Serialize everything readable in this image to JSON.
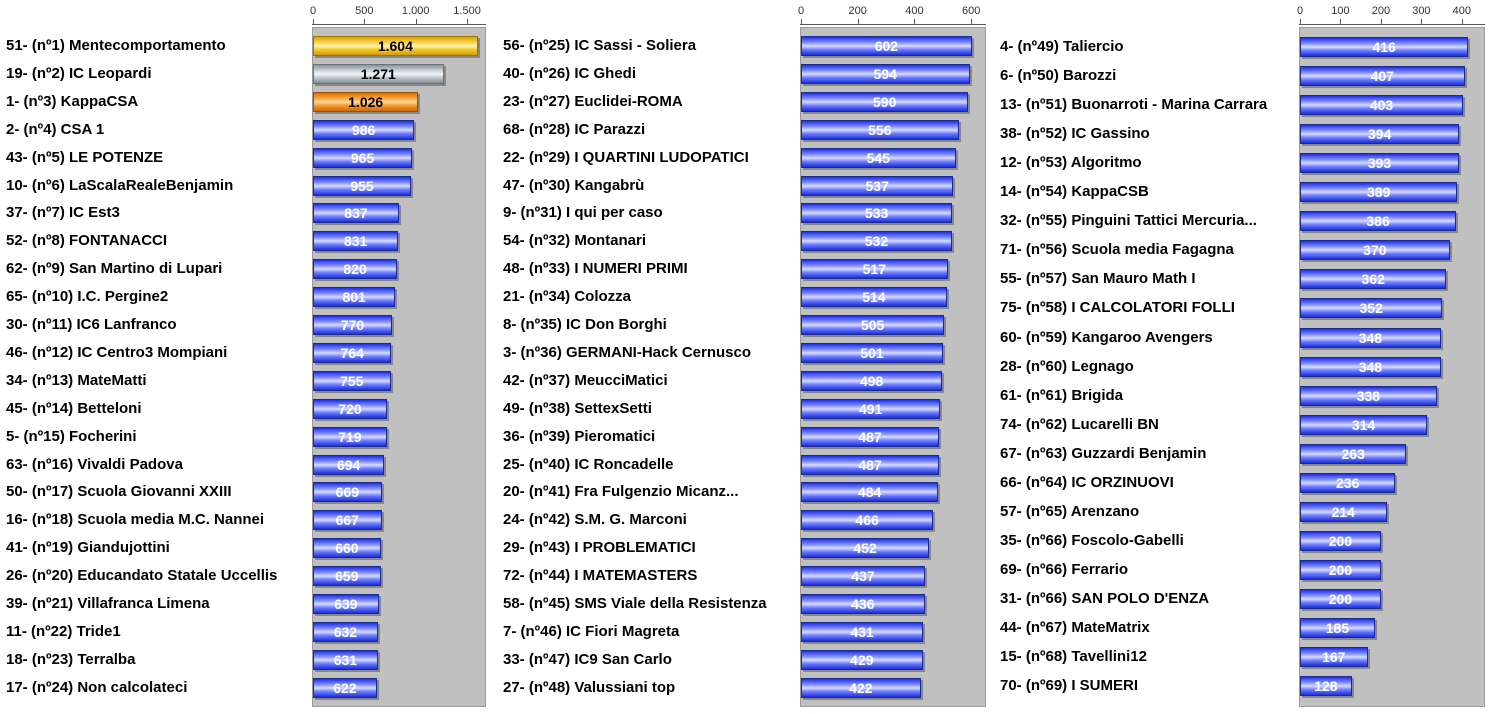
{
  "chart_data": [
    {
      "type": "bar",
      "orientation": "horizontal",
      "xlim": [
        0,
        1600
      ],
      "ticks": [
        0,
        500,
        1000,
        1500
      ],
      "tick_labels": [
        "0",
        "500",
        "1.000",
        "1.500"
      ],
      "categories": [
        "51- (nº1) Mentecomportamento",
        "19- (nº2) IC Leopardi",
        "1- (nº3) KappaCSA",
        "2- (nº4) CSA 1",
        "43- (nº5) LE POTENZE",
        "10- (nº6) LaScalaRealeBenjamin",
        "37- (nº7) IC Est3",
        "52- (nº8) FONTANACCI",
        "62- (nº9) San Martino di Lupari",
        "65- (nº10) I.C. Pergine2",
        "30- (nº11) IC6 Lanfranco",
        "46- (nº12) IC Centro3 Mompiani",
        "34- (nº13) MateMatti",
        "45- (nº14) Betteloni",
        "5- (nº15) Focherini",
        "63- (nº16) Vivaldi Padova",
        "50- (nº17) Scuola Giovanni XXIII",
        "16- (nº18) Scuola media M.C. Nannei",
        "41- (nº19) Giandujottini",
        "26- (nº20) Educandato Statale Uccellis",
        "39- (nº21) Villafranca Limena",
        "11- (nº22) Tride1",
        "18- (nº23) Terralba",
        "17- (nº24) Non calcolateci"
      ],
      "values": [
        1604,
        1271,
        1026,
        986,
        965,
        955,
        837,
        831,
        820,
        801,
        770,
        764,
        755,
        720,
        719,
        694,
        669,
        667,
        660,
        659,
        639,
        632,
        631,
        622
      ],
      "value_labels": [
        "1.604",
        "1.271",
        "1.026",
        "986",
        "965",
        "955",
        "837",
        "831",
        "820",
        "801",
        "770",
        "764",
        "755",
        "720",
        "719",
        "694",
        "669",
        "667",
        "660",
        "659",
        "639",
        "632",
        "631",
        "622"
      ]
    },
    {
      "type": "bar",
      "orientation": "horizontal",
      "xlim": [
        0,
        620
      ],
      "ticks": [
        0,
        200,
        400,
        600
      ],
      "tick_labels": [
        "0",
        "200",
        "400",
        "600"
      ],
      "categories": [
        "56- (nº25) IC Sassi - Soliera",
        "40- (nº26) IC Ghedi",
        "23- (nº27) Euclidei-ROMA",
        "68- (nº28) IC Parazzi",
        "22- (nº29) I QUARTINI LUDOPATICI",
        "47- (nº30) Kangabrù",
        "9- (nº31) I qui per caso",
        "54- (nº32) Montanari",
        "48- (nº33) I NUMERI PRIMI",
        "21- (nº34) Colozza",
        "8- (nº35) IC Don Borghi",
        "3- (nº36) GERMANI-Hack Cernusco",
        "42- (nº37) MeucciMatici",
        "49- (nº38) SettexSetti",
        "36- (nº39) Pieromatici",
        "25- (nº40) IC Roncadelle",
        "20- (nº41) Fra Fulgenzio Micanz...",
        "24- (nº42) S.M. G. Marconi",
        "29- (nº43) I PROBLEMATICI",
        "72- (nº44) I MATEMASTERS",
        "58- (nº45) SMS Viale della Resistenza",
        "7- (nº46) IC Fiori Magreta",
        "33- (nº47) IC9 San Carlo",
        "27- (nº48) Valussiani top"
      ],
      "values": [
        602,
        594,
        590,
        556,
        545,
        537,
        533,
        532,
        517,
        514,
        505,
        501,
        498,
        491,
        487,
        487,
        484,
        466,
        452,
        437,
        436,
        431,
        429,
        422
      ],
      "value_labels": [
        "602",
        "594",
        "590",
        "556",
        "545",
        "537",
        "533",
        "532",
        "517",
        "514",
        "505",
        "501",
        "498",
        "491",
        "487",
        "487",
        "484",
        "466",
        "452",
        "437",
        "436",
        "431",
        "429",
        "422"
      ]
    },
    {
      "type": "bar",
      "orientation": "horizontal",
      "xlim": [
        0,
        420
      ],
      "ticks": [
        0,
        100,
        200,
        300,
        400
      ],
      "tick_labels": [
        "0",
        "100",
        "200",
        "300",
        "400"
      ],
      "categories": [
        "4- (nº49) Taliercio",
        "6- (nº50) Barozzi",
        "13- (nº51) Buonarroti - Marina Carrara",
        "38- (nº52) IC Gassino",
        "12- (nº53) Algoritmo",
        "14- (nº54) KappaCSB",
        "32- (nº55) Pinguini Tattici Mercuria...",
        "71- (nº56) Scuola media Fagagna",
        "55- (nº57) San Mauro Math I",
        "75- (nº58) I CALCOLATORI FOLLI",
        "60- (nº59) Kangaroo Avengers",
        "28- (nº60) Legnago",
        "61- (nº61) Brigida",
        "74- (nº62) Lucarelli BN",
        "67- (nº63) Guzzardi Benjamin",
        "66- (nº64) IC ORZINUOVI",
        "57- (nº65) Arenzano",
        "35- (nº66) Foscolo-Gabelli",
        "69- (nº66) Ferrario",
        "31- (nº66) SAN POLO D'ENZA",
        "44- (nº67) MateMatrix",
        "15- (nº68) Tavellini12",
        "70- (nº69) I SUMERI"
      ],
      "values": [
        416,
        407,
        403,
        394,
        393,
        389,
        386,
        370,
        362,
        352,
        348,
        348,
        338,
        314,
        263,
        236,
        214,
        200,
        200,
        200,
        185,
        167,
        128
      ],
      "value_labels": [
        "416",
        "407",
        "403",
        "394",
        "393",
        "389",
        "386",
        "370",
        "362",
        "352",
        "348",
        "348",
        "338",
        "314",
        "263",
        "236",
        "214",
        "200",
        "200",
        "200",
        "185",
        "167",
        "128"
      ]
    }
  ],
  "colors": {
    "plot_background": "#c0c0c0",
    "bar_default": "#2e3ff0",
    "rank1": "#f2c10f",
    "rank2": "#c9d0d5",
    "rank3": "#f29a20"
  }
}
